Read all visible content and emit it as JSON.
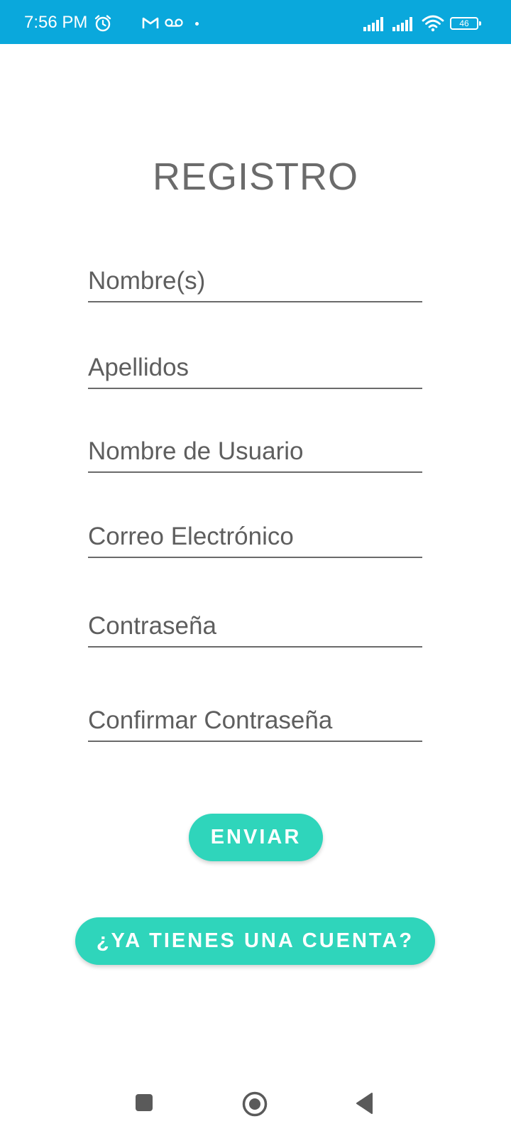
{
  "status_bar": {
    "time": "7:56 PM",
    "battery": "46",
    "background_color": "#0aa8dc",
    "icons": [
      "alarm-icon",
      "gmail-icon",
      "voicemail-icon",
      "notification-dot-icon",
      "signal-icon",
      "signal-icon",
      "wifi-icon",
      "battery-icon"
    ]
  },
  "form": {
    "title": "REGISTRO",
    "fields": [
      {
        "placeholder": "Nombre(s)",
        "value": ""
      },
      {
        "placeholder": "Apellidos",
        "value": ""
      },
      {
        "placeholder": "Nombre de Usuario",
        "value": ""
      },
      {
        "placeholder": "Correo Electrónico",
        "value": ""
      },
      {
        "placeholder": "Contraseña",
        "value": ""
      },
      {
        "placeholder": "Confirmar Contraseña",
        "value": ""
      }
    ],
    "submit_label": "ENVIAR",
    "login_label": "¿YA TIENES UNA CUENTA?",
    "accent_color": "#2fd5bb"
  },
  "nav_bar": {
    "icons": [
      "recents-icon",
      "home-icon",
      "back-icon"
    ]
  }
}
